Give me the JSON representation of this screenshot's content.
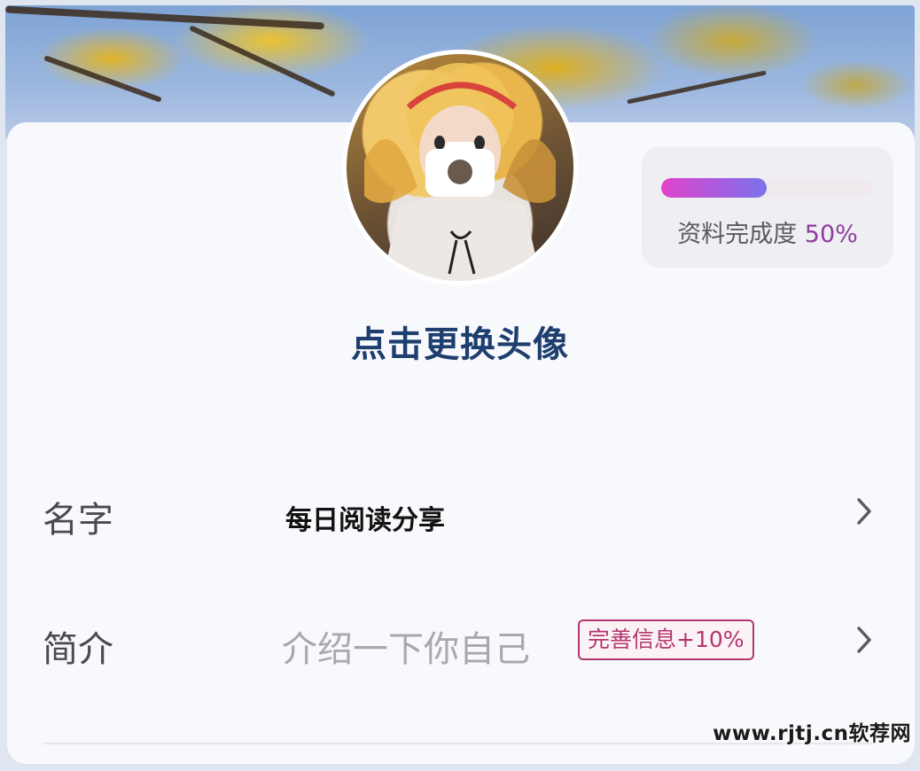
{
  "profile": {
    "avatar_caption": "点击更换头像",
    "completion": {
      "label": "资料完成度",
      "value_text": "50%",
      "progress_fraction": 0.5
    },
    "rows": {
      "name": {
        "label": "名字",
        "value": "每日阅读分享"
      },
      "bio": {
        "label": "简介",
        "placeholder": "介绍一下你自己",
        "badge": "完善信息+10%"
      }
    }
  },
  "watermark": "www.rjtj.cn软荐网",
  "colors": {
    "caption": "#1d3e6e",
    "progress_start": "#e044c9",
    "progress_end": "#7b73ea",
    "badge": "#b4356d",
    "completion_value": "#8f3d9e"
  },
  "icons": {
    "camera": "camera-icon",
    "chevron": "chevron-right-icon"
  }
}
